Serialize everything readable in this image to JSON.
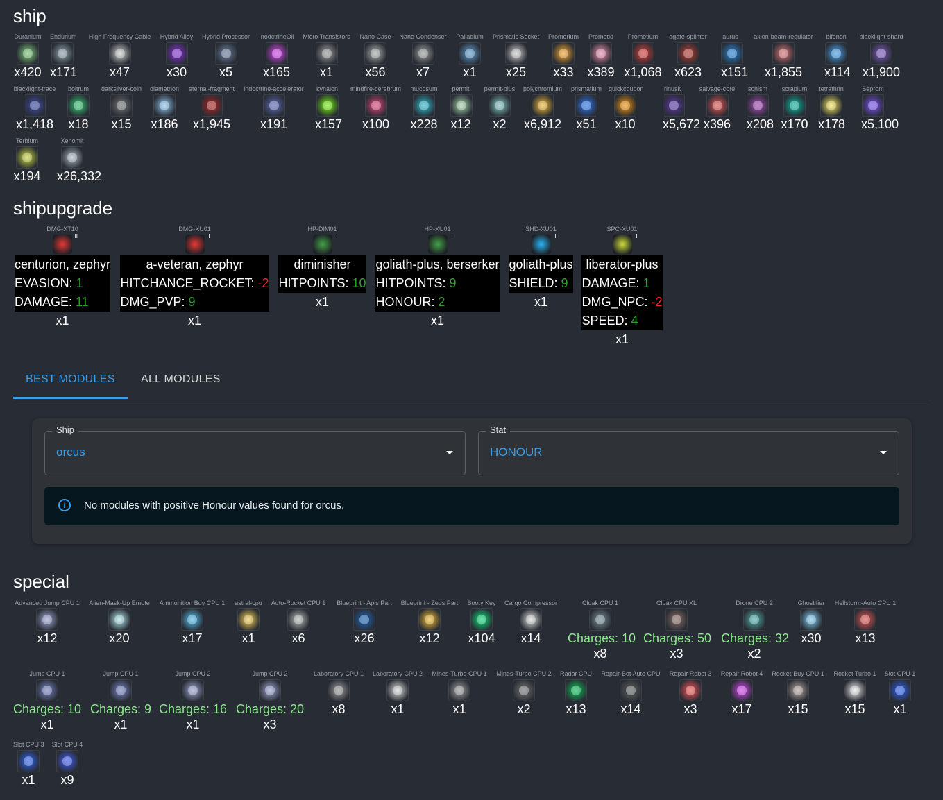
{
  "sections": {
    "ship": "ship",
    "shipupgrade": "shipupgrade",
    "special": "special"
  },
  "ship_items": [
    {
      "label": "Duranium",
      "count": "x420",
      "color": "#7fd07a"
    },
    {
      "label": "Endurium",
      "count": "x171",
      "color": "#8fa3b0"
    },
    {
      "label": "High Frequency Cable",
      "count": "x47",
      "color": "#cfcfcf"
    },
    {
      "label": "Hybrid Alloy",
      "count": "x30",
      "color": "#8a2be2"
    },
    {
      "label": "Hybrid Processor",
      "count": "x5",
      "color": "#6a7fa0"
    },
    {
      "label": "InodctrineOil",
      "count": "x165",
      "color": "#e040fb"
    },
    {
      "label": "Micro Transistors",
      "count": "x1",
      "color": "#9e9e9e"
    },
    {
      "label": "Nano Case",
      "count": "x56",
      "color": "#b0b0b0"
    },
    {
      "label": "Nano Condenser",
      "count": "x7",
      "color": "#a0a0a0"
    },
    {
      "label": "Palladium",
      "count": "x1",
      "color": "#5ea0d8"
    },
    {
      "label": "Prismatic Socket",
      "count": "x25",
      "color": "#d0d0d0"
    },
    {
      "label": "Promerium",
      "count": "x33",
      "color": "#ffa726"
    },
    {
      "label": "Prometid",
      "count": "x389",
      "color": "#f48fb1"
    },
    {
      "label": "Prometium",
      "count": "x1,068",
      "color": "#e53935"
    },
    {
      "label": "agate-splinter",
      "count": "x623",
      "color": "#c0392b"
    },
    {
      "label": "aurus",
      "count": "x151",
      "color": "#1e88e5"
    },
    {
      "label": "axion-beam-regulator",
      "count": "x1,855",
      "color": "#e57373"
    },
    {
      "label": "bifenon",
      "count": "x114",
      "color": "#42a5f5"
    },
    {
      "label": "blacklight-shard",
      "count": "x1,900",
      "color": "#7e57c2"
    },
    {
      "label": "blacklight-trace",
      "count": "x1,418",
      "color": "#3949ab"
    },
    {
      "label": "boltrum",
      "count": "x18",
      "color": "#2ecc71"
    },
    {
      "label": "darksilver-coin",
      "count": "x15",
      "color": "#757575"
    },
    {
      "label": "diametrion",
      "count": "x186",
      "color": "#90caf9"
    },
    {
      "label": "eternal-fragment",
      "count": "x1,945",
      "color": "#b71c1c"
    },
    {
      "label": "indoctrine-accelerator",
      "count": "x191",
      "color": "#5c6bc0"
    },
    {
      "label": "kyhalon",
      "count": "x157",
      "color": "#76ff03"
    },
    {
      "label": "mindfire-cerebrum",
      "count": "x100",
      "color": "#ec407a"
    },
    {
      "label": "mucosum",
      "count": "x228",
      "color": "#26c6da"
    },
    {
      "label": "permit",
      "count": "x12",
      "color": "#a5d6a7"
    },
    {
      "label": "permit-plus",
      "count": "x2",
      "color": "#80cbc4"
    },
    {
      "label": "polychromium",
      "count": "x6,912",
      "color": "#fbc02d"
    },
    {
      "label": "prismatium",
      "count": "x51",
      "color": "#2979ff"
    },
    {
      "label": "quickcoupon",
      "count": "x10",
      "color": "#ff9800"
    },
    {
      "label": "rinusk",
      "count": "x5,672",
      "color": "#5e35b1"
    },
    {
      "label": "salvage-core",
      "count": "x396",
      "color": "#ef5350"
    },
    {
      "label": "schism",
      "count": "x208",
      "color": "#ab47bc"
    },
    {
      "label": "scrapium",
      "count": "x170",
      "color": "#00bfa5"
    },
    {
      "label": "tetrathrin",
      "count": "x178",
      "color": "#ffee58"
    },
    {
      "label": "Seprom",
      "count": "x5,100",
      "color": "#7c4dff"
    },
    {
      "label": "Terbium",
      "count": "x194",
      "color": "#cddc39"
    },
    {
      "label": "Xenomit",
      "count": "x26,332",
      "color": "#b0bec5"
    }
  ],
  "upgrades": [
    {
      "label": "DMG-XT10",
      "level": "II",
      "color": "#e53935",
      "rows": [
        {
          "title": "centurion, zephyr"
        },
        {
          "k": "EVASION: ",
          "v": "1",
          "s": "pos"
        },
        {
          "k": "DAMAGE: ",
          "v": "11",
          "s": "pos"
        }
      ],
      "count": "x1"
    },
    {
      "label": "DMG-XU01",
      "level": "I",
      "color": "#e53935",
      "rows": [
        {
          "title": "a-veteran, zephyr"
        },
        {
          "k": "HITCHANCE_ROCKET: ",
          "v": "-2",
          "s": "neg"
        },
        {
          "k": "DMG_PVP: ",
          "v": "9",
          "s": "pos"
        }
      ],
      "count": "x1"
    },
    {
      "label": "HP-DIM01",
      "level": "I",
      "color": "#43a047",
      "rows": [
        {
          "title": "diminisher"
        },
        {
          "k": "HITPOINTS: ",
          "v": "10",
          "s": "pos"
        }
      ],
      "count": "x1"
    },
    {
      "label": "HP-XU01",
      "level": "I",
      "color": "#43a047",
      "rows": [
        {
          "title": "goliath-plus, berserker"
        },
        {
          "k": "HITPOINTS: ",
          "v": "9",
          "s": "pos"
        },
        {
          "k": "HONOUR: ",
          "v": "2",
          "s": "pos"
        }
      ],
      "count": "x1"
    },
    {
      "label": "SHD-XU01",
      "level": "I",
      "color": "#29b6f6",
      "rows": [
        {
          "title": "goliath-plus"
        },
        {
          "k": "SHIELD: ",
          "v": "9",
          "s": "pos"
        }
      ],
      "count": "x1"
    },
    {
      "label": "SPC-XU01",
      "level": "I",
      "color": "#cddc39",
      "rows": [
        {
          "title": "liberator-plus"
        },
        {
          "k": "DAMAGE: ",
          "v": "1",
          "s": "pos"
        },
        {
          "k": "DMG_NPC: ",
          "v": "-2",
          "s": "neg"
        },
        {
          "k": "SPEED: ",
          "v": "4",
          "s": "pos"
        }
      ],
      "count": "x1"
    }
  ],
  "tabs": {
    "best": "BEST MODULES",
    "all": "ALL MODULES"
  },
  "form": {
    "ship_label": "Ship",
    "ship_value": "orcus",
    "stat_label": "Stat",
    "stat_value": "HONOUR",
    "alert": "No modules with positive Honour values found for orcus."
  },
  "special_items": [
    {
      "label": "Advanced Jump CPU 1",
      "count": "x12",
      "color": "#9fa8da"
    },
    {
      "label": "Alien-Mask-Up Emote",
      "count": "x20",
      "color": "#b2ebf2"
    },
    {
      "label": "Ammunition Buy CPU 1",
      "count": "x17",
      "color": "#4fc3f7"
    },
    {
      "label": "astral-cpu",
      "count": "x1",
      "color": "#ffd54f"
    },
    {
      "label": "Auto-Rocket CPU 1",
      "count": "x6",
      "color": "#bdbdbd"
    },
    {
      "label": "Blueprint - Apis Part",
      "count": "x26",
      "color": "#1565c0"
    },
    {
      "label": "Blueprint - Zeus Part",
      "count": "x12",
      "color": "#fbc02d"
    },
    {
      "label": "Booty Key",
      "count": "x104",
      "color": "#00e676"
    },
    {
      "label": "Cargo Compressor",
      "count": "x14",
      "color": "#e0e0e0"
    },
    {
      "label": "Cloak CPU 1",
      "charges": "Charges: 10",
      "count": "x8",
      "color": "#78909c"
    },
    {
      "label": "Cloak CPU XL",
      "charges": "Charges: 50",
      "count": "x3",
      "color": "#8d6e63"
    },
    {
      "label": "Drone CPU 2",
      "charges": "Charges: 32",
      "count": "x2",
      "color": "#4db6ac"
    },
    {
      "label": "Ghostifier",
      "count": "x30",
      "color": "#81d4fa"
    },
    {
      "label": "Hellstorm-Auto CPU 1",
      "count": "x13",
      "color": "#ef5350"
    },
    {
      "label": "Jump CPU 1",
      "charges": "Charges: 10",
      "count": "x1",
      "color": "#7986cb"
    },
    {
      "label": "Jump CPU 1",
      "charges": "Charges: 9",
      "count": "x1",
      "color": "#7986cb"
    },
    {
      "label": "Jump CPU 2",
      "charges": "Charges: 16",
      "count": "x1",
      "color": "#9fa8da"
    },
    {
      "label": "Jump CPU 2",
      "charges": "Charges: 20",
      "count": "x3",
      "color": "#9fa8da"
    },
    {
      "label": "Laboratory CPU 1",
      "count": "x8",
      "color": "#9e9e9e"
    },
    {
      "label": "Laboratory CPU 2",
      "count": "x1",
      "color": "#e0e0e0"
    },
    {
      "label": "Mines-Turbo CPU 1",
      "count": "x1",
      "color": "#9e9e9e"
    },
    {
      "label": "Mines-Turbo CPU 2",
      "count": "x2",
      "color": "#757575"
    },
    {
      "label": "Radar CPU",
      "count": "x13",
      "color": "#00c853"
    },
    {
      "label": "Repair-Bot Auto CPU",
      "count": "x14",
      "color": "#616161"
    },
    {
      "label": "Repair Robot 3",
      "count": "x3",
      "color": "#ff5252"
    },
    {
      "label": "Repair Robot 4",
      "count": "x17",
      "color": "#e040fb"
    },
    {
      "label": "Rocket-Buy CPU 1",
      "count": "x15",
      "color": "#bcaaa4"
    },
    {
      "label": "Rocket Turbo 1",
      "count": "x15",
      "color": "#eeeeee"
    },
    {
      "label": "Slot CPU 1",
      "count": "x1",
      "color": "#2962ff"
    },
    {
      "label": "Slot CPU 3",
      "count": "x1",
      "color": "#2962ff"
    },
    {
      "label": "Slot CPU 4",
      "count": "x9",
      "color": "#3d5afe"
    }
  ]
}
